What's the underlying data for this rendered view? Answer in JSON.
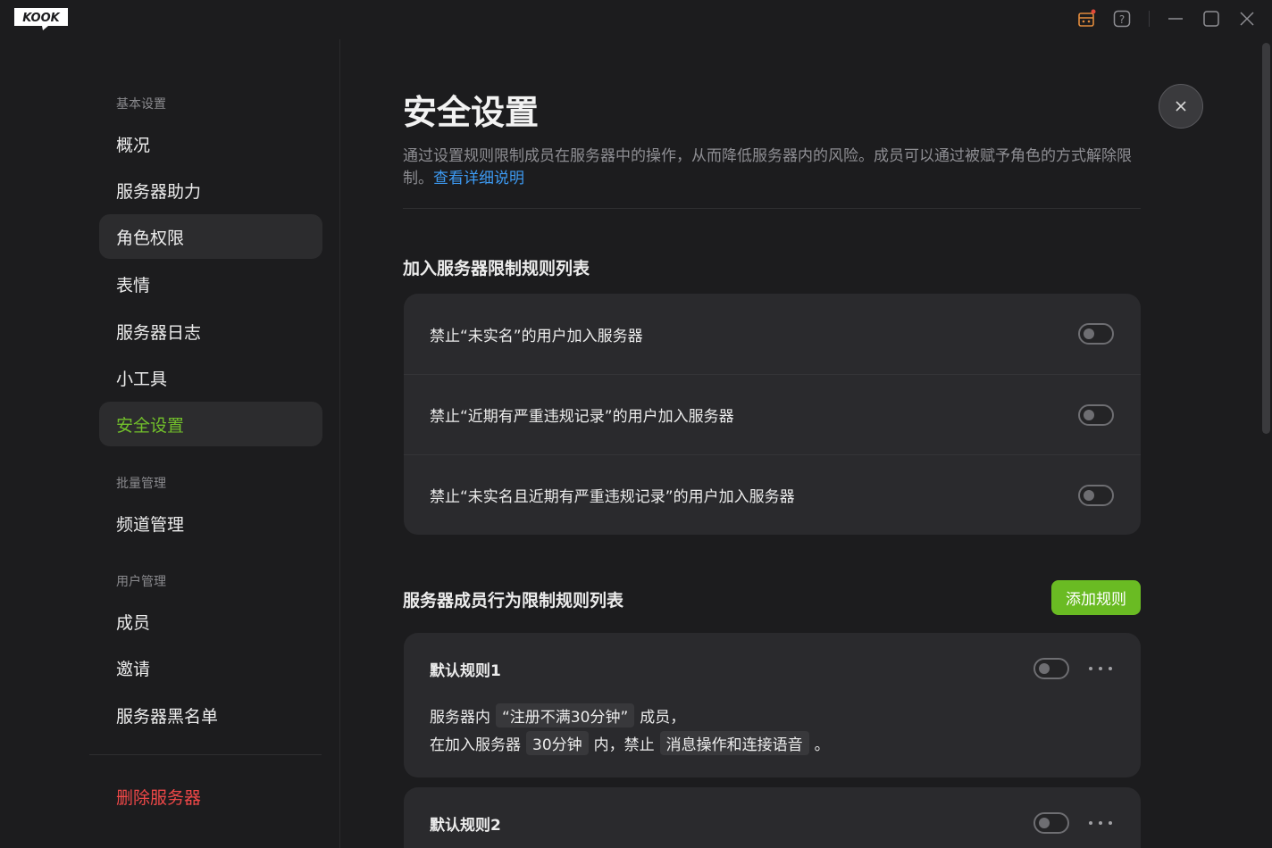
{
  "app": {
    "logo_text": "KOOK"
  },
  "titlebar": {
    "icons": [
      "gift-box-icon",
      "help-icon",
      "minimize-icon",
      "maximize-icon",
      "close-icon"
    ],
    "notification_color": "#e0483a"
  },
  "sidebar": {
    "groups": [
      {
        "label": "基本设置"
      },
      {
        "label": "批量管理"
      },
      {
        "label": "用户管理"
      }
    ],
    "items": [
      {
        "label": "概况"
      },
      {
        "label": "服务器助力"
      },
      {
        "label": "角色权限"
      },
      {
        "label": "表情"
      },
      {
        "label": "服务器日志"
      },
      {
        "label": "小工具"
      },
      {
        "label": "安全设置"
      },
      {
        "label": "频道管理"
      },
      {
        "label": "成员"
      },
      {
        "label": "邀请"
      },
      {
        "label": "服务器黑名单"
      },
      {
        "label": "删除服务器"
      }
    ],
    "active_item": "安全设置",
    "accent_color": "#72c02b",
    "danger_color": "#f04848"
  },
  "main": {
    "title": "安全设置",
    "description": "通过设置规则限制成员在服务器中的操作，从而降低服务器内的风险。成员可以通过被赋予角色的方式解除限制。",
    "description_link": "查看详细说明",
    "join_section": {
      "title": "加入服务器限制规则列表",
      "rules": [
        {
          "label": "禁止“未实名”的用户加入服务器",
          "enabled": false
        },
        {
          "label": "禁止“近期有严重违规记录”的用户加入服务器",
          "enabled": false
        },
        {
          "label": "禁止“未实名且近期有严重违规记录”的用户加入服务器",
          "enabled": false
        }
      ]
    },
    "behavior_section": {
      "title": "服务器成员行为限制规则列表",
      "add_button": "添加规则",
      "rules": [
        {
          "name": "默认规则1",
          "enabled": false,
          "line1_prefix": "服务器内",
          "line1_tag": "“注册不满30分钟”",
          "line1_suffix": "成员，",
          "line2_prefix": "在加入服务器",
          "line2_tag1": "30分钟",
          "line2_middle": "内，禁止",
          "line2_tag2": "消息操作和连接语音",
          "line2_suffix": "。"
        },
        {
          "name": "默认规则2",
          "enabled": false
        }
      ]
    }
  }
}
